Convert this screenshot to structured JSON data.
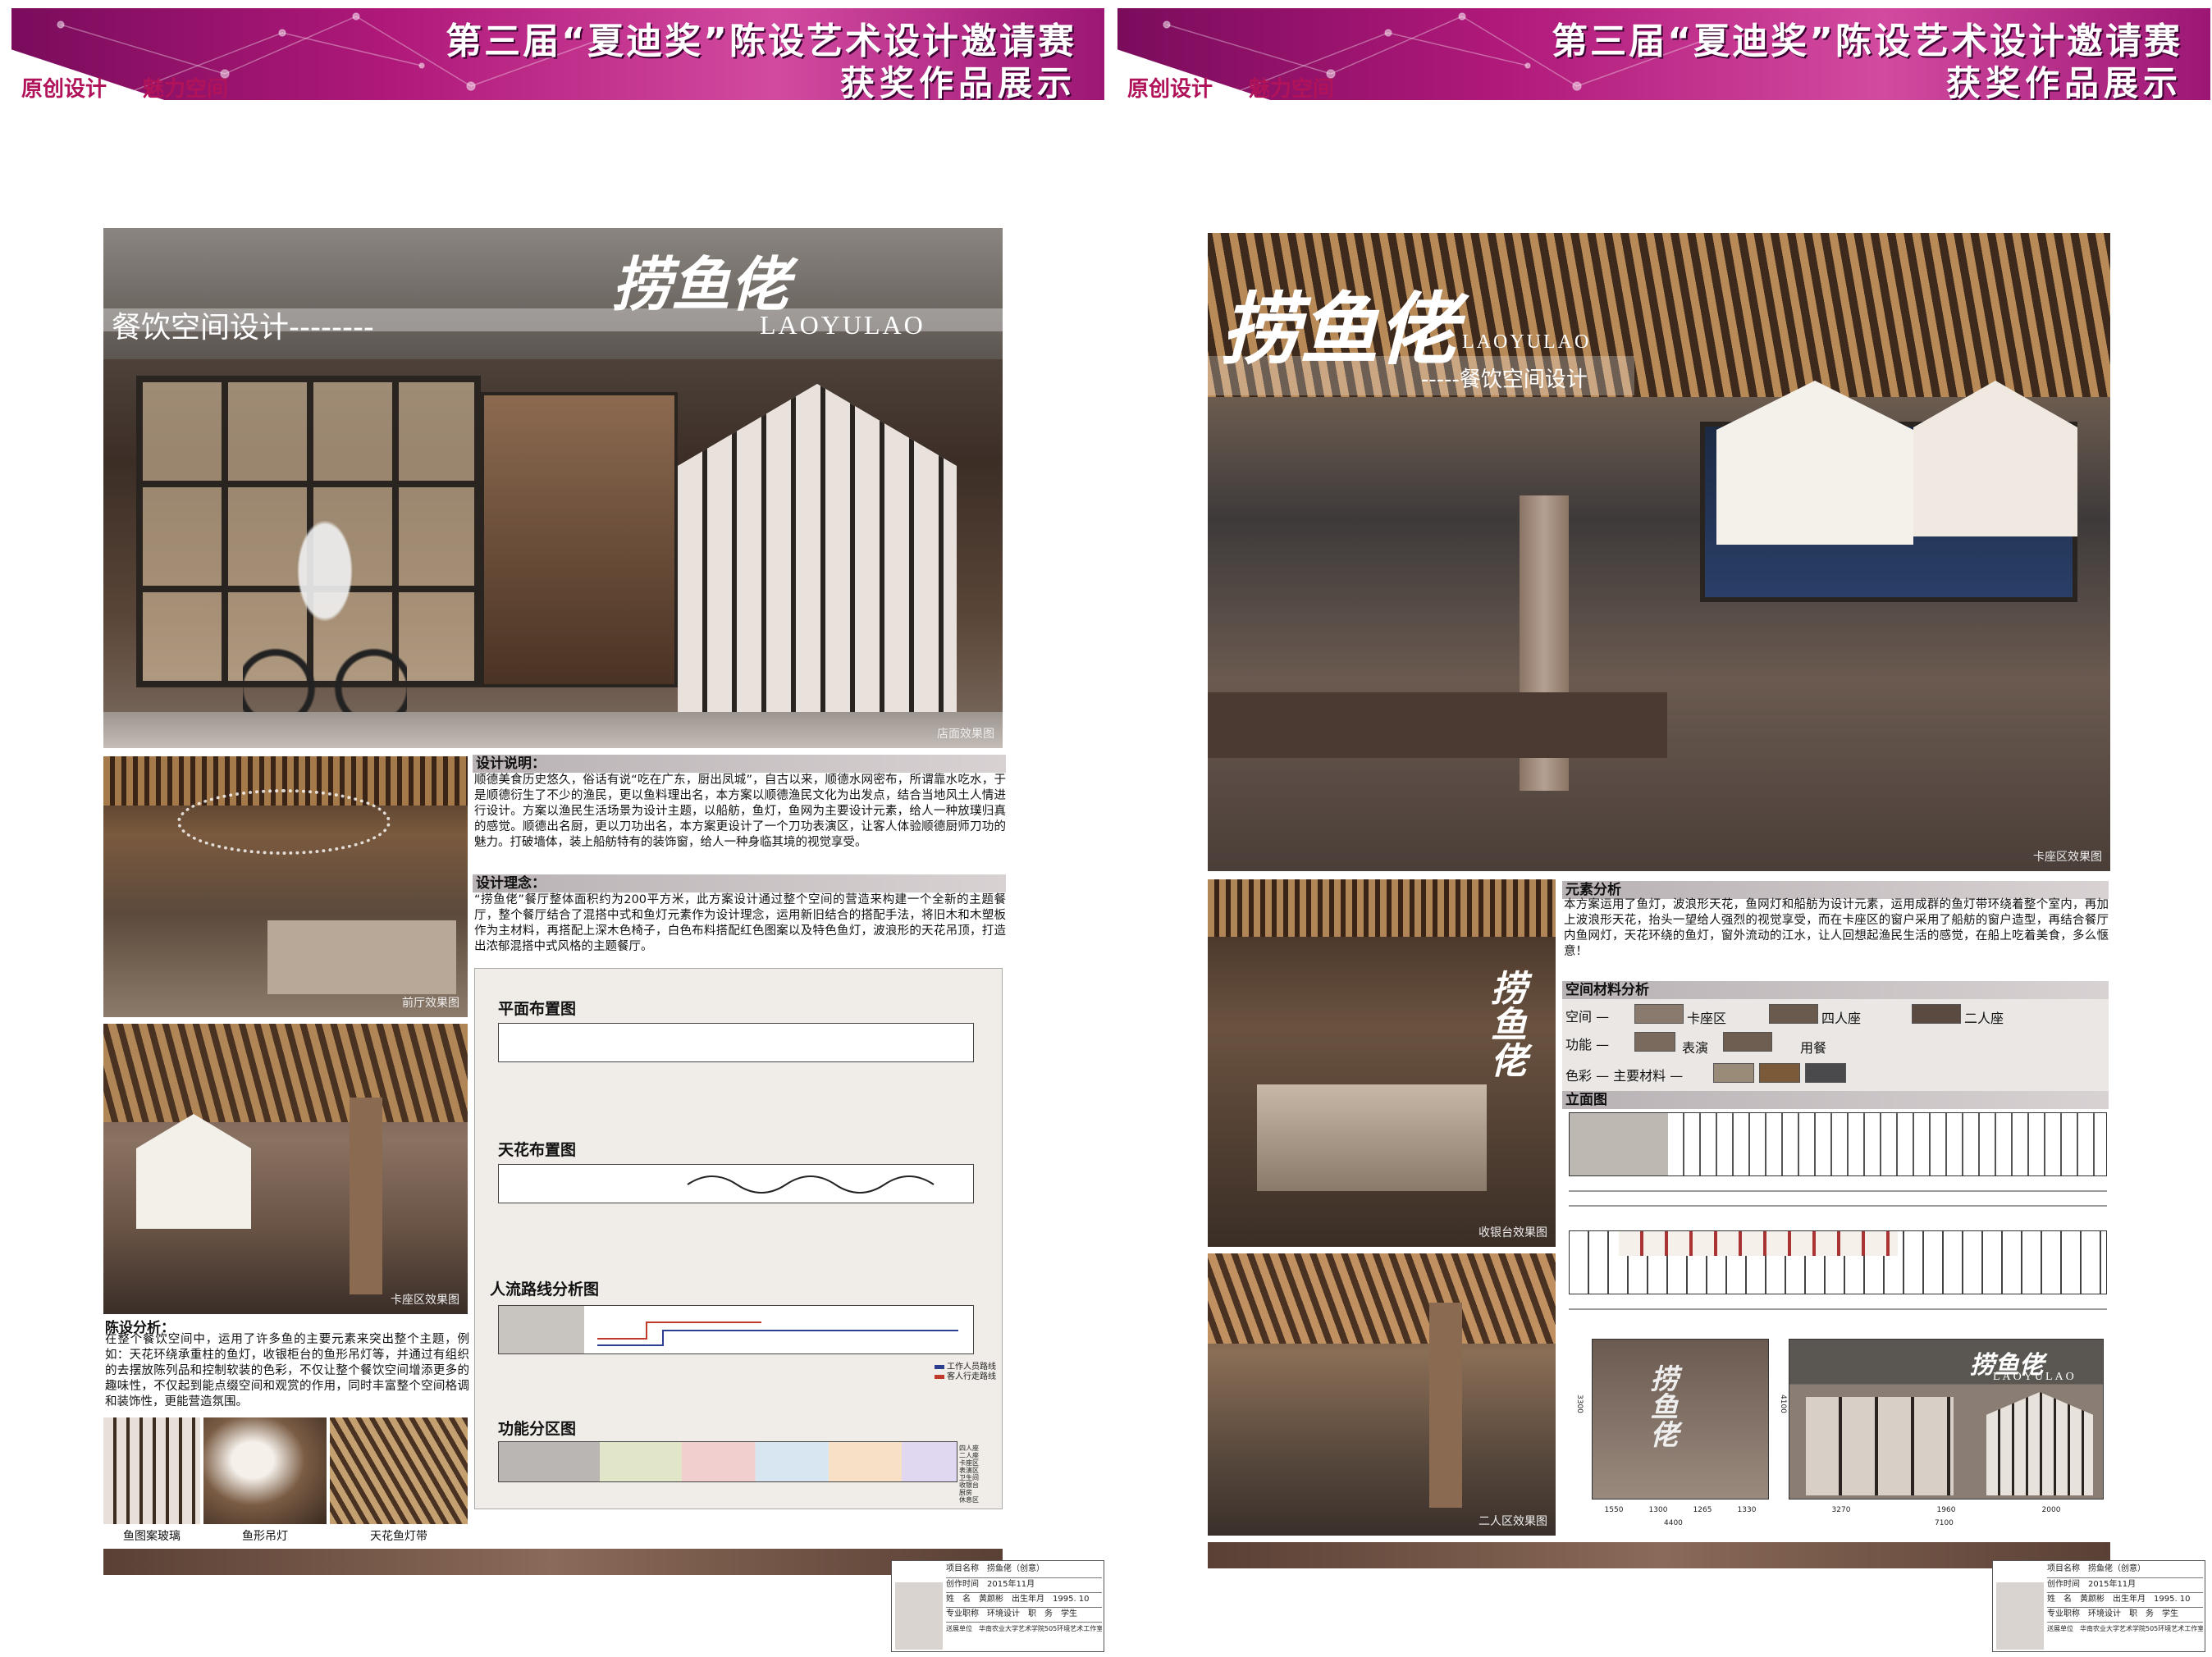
{
  "banner": {
    "title": "第三届“夏迪奖”陈设艺术设计邀请赛",
    "subtitle": "获奖作品展示",
    "tagline_1": "原创设计",
    "tagline_2": "魅力空间",
    "color": "#b0197a"
  },
  "left": {
    "hero": {
      "logo_cn": "捞鱼佬",
      "logo_en": "LAOYULAO",
      "heading": "餐饮空间设计--------",
      "caption": "店面效果图"
    },
    "photo_front": {
      "caption": "前厅效果图"
    },
    "photo_booth": {
      "caption": "卡座区效果图"
    },
    "design_desc": {
      "title": "设计说明：",
      "text": "顺德美食历史悠久，俗话有说“吃在广东，厨出凤城”，自古以来，顺德水网密布，所谓靠水吃水，于是顺德衍生了不少的渔民，更以鱼料理出名，本方案以顺德渔民文化为出发点，结合当地风土人情进行设计。方案以渔民生活场景为设计主题，以船舫，鱼灯，鱼网为主要设计元素，给人一种放璞归真的感觉。顺德出名厨，更以刀功出名，本方案更设计了一个刀功表演区，让客人体验顺德厨师刀功的魅力。打破墙体，装上船舫特有的装饰窗，给人一种身临其境的视觉享受。"
    },
    "design_concept": {
      "title": "设计理念：",
      "text": "“捞鱼佬”餐厅整体面积约为200平方米，此方案设计通过整个空间的营造来构建一个全新的主题餐厅，整个餐厅结合了混搭中式和鱼灯元素作为设计理念，运用新旧结合的搭配手法，将旧木和木塑板作为主材料，再搭配上深木色椅子，白色布料搭配红色图案以及特色鱼灯，波浪形的天花吊顶，打造出浓郁混搭中式风格的主题餐厅。"
    },
    "plans": [
      {
        "title": "平面布置图"
      },
      {
        "title": "天花布置图"
      },
      {
        "title": "人流路线分析图",
        "legend": [
          "工作人员路线",
          "客人行走路线"
        ]
      },
      {
        "title": "功能分区图",
        "legend": [
          "四人座",
          "二人座",
          "卡座区",
          "表演区",
          "卫生间",
          "收银台",
          "厨房",
          "休息区"
        ]
      }
    ],
    "display": {
      "title": "陈设分析：",
      "text": "在整个餐饮空间中，运用了许多鱼的主要元素来突出整个主题，例如：天花环绕承重柱的鱼灯，收银柜台的鱼形吊灯等，并通过有组织的去摆放陈列品和控制软装的色彩，不仅让整个餐饮空间增添更多的趣味性，不仅起到能点缀空间和观赏的作用，同时丰富整个空间格调和装饰性，更能营造氛围。"
    },
    "details": [
      "鱼图案玻璃",
      "鱼形吊灯",
      "天花鱼灯带"
    ]
  },
  "right": {
    "hero": {
      "logo_cn": "捞鱼佬",
      "logo_en": "LAOYULAO",
      "heading": "-----餐饮空间设计",
      "caption": "卡座区效果图"
    },
    "photo_cashier": {
      "caption": "收银台效果图"
    },
    "photo_two": {
      "caption": "二人区效果图"
    },
    "elements": {
      "title": "元素分析",
      "text": "本方案运用了鱼灯，波浪形天花，鱼网灯和船舫为设计元素，运用成群的鱼灯带环绕着整个室内，再加上波浪形天花，抬头一望给人强烈的视觉享受，而在卡座区的窗户采用了船舫的窗户造型，再结合餐厅内鱼网灯，天花环绕的鱼灯，窗外流动的江水，让人回想起渔民生活的感觉，在船上吃着美食，多么惬意！"
    },
    "materials": {
      "title": "空间材料分析",
      "row1_label": "空间 —",
      "row1_items": [
        "卡座区",
        "四人座",
        "二人座"
      ],
      "row2_label": "功能 —",
      "row2_items": [
        "表演",
        "用餐"
      ],
      "row3_label": "色彩 — 主要材料 —"
    },
    "elevation": {
      "title": "立面图",
      "sign_cn": "捞鱼佬",
      "sign_en": "LAOYULAO",
      "dims_a": [
        "1550",
        "1300",
        "1265",
        "1330"
      ],
      "total_a": "4400",
      "dims_b": [
        "3270",
        "1960",
        "2000"
      ],
      "total_b": "7100",
      "height_a": "3300",
      "height_b": "4100"
    }
  },
  "idcard": {
    "rows": [
      [
        "项目名称",
        "捞鱼佬（创意）"
      ],
      [
        "创作时间",
        "2015年11月"
      ],
      [
        "姓　名",
        "黄颜彬",
        "出生年月",
        "1995. 10"
      ],
      [
        "专业职称",
        "环境设计",
        "职　务",
        "学生"
      ],
      [
        "送展单位",
        "华南农业大学艺术学院505环境艺术工作室"
      ]
    ]
  }
}
